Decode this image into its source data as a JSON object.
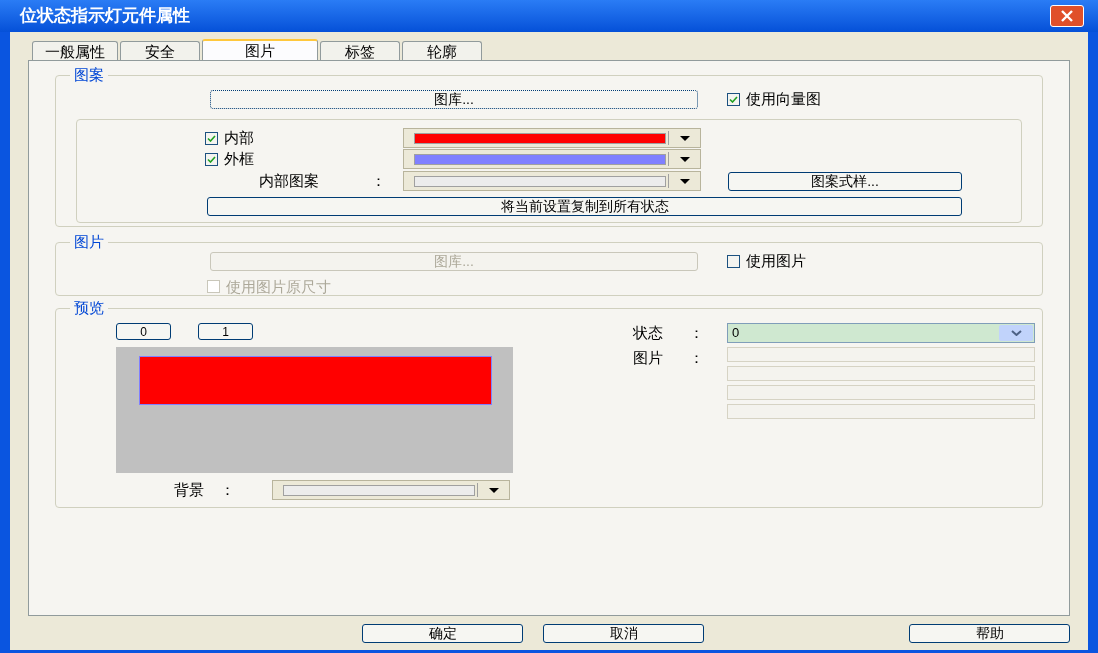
{
  "window": {
    "title": "位状态指示灯元件属性"
  },
  "tabs": [
    {
      "label": "一般属性",
      "selected": false
    },
    {
      "label": "安全",
      "selected": false
    },
    {
      "label": "图片",
      "selected": true
    },
    {
      "label": "标签",
      "selected": false
    },
    {
      "label": "轮廓",
      "selected": false
    }
  ],
  "pattern_group": {
    "title": "图案",
    "library_button": {
      "label": "图库...",
      "disabled": false
    },
    "use_vector": {
      "label": "使用向量图",
      "checked": true
    },
    "fill": {
      "label": "内部",
      "checked": true,
      "color": "#ff0000"
    },
    "border": {
      "label": "外框",
      "checked": true,
      "color": "#8080ff"
    },
    "inner_pattern": {
      "label": "内部图案",
      "separator": "："
    },
    "pattern_style_button": "图案式样...",
    "copy_button": "将当前设置复制到所有状态"
  },
  "picture_group": {
    "title": "图片",
    "library_button": {
      "label": "图库...",
      "disabled": true
    },
    "use_picture": {
      "label": "使用图片",
      "checked": false,
      "disabled": false
    },
    "original_size": {
      "label": "使用图片原尺寸",
      "checked": false,
      "disabled": true
    }
  },
  "preview_group": {
    "title": "预览",
    "state_buttons": [
      "0",
      "1"
    ],
    "state": {
      "label": "状态",
      "separator": "：",
      "value": "0"
    },
    "picture": {
      "label": "图片",
      "separator": "："
    },
    "background": {
      "label": "背景",
      "separator": "："
    }
  },
  "buttons": [
    "确定",
    "取消",
    "帮助"
  ]
}
